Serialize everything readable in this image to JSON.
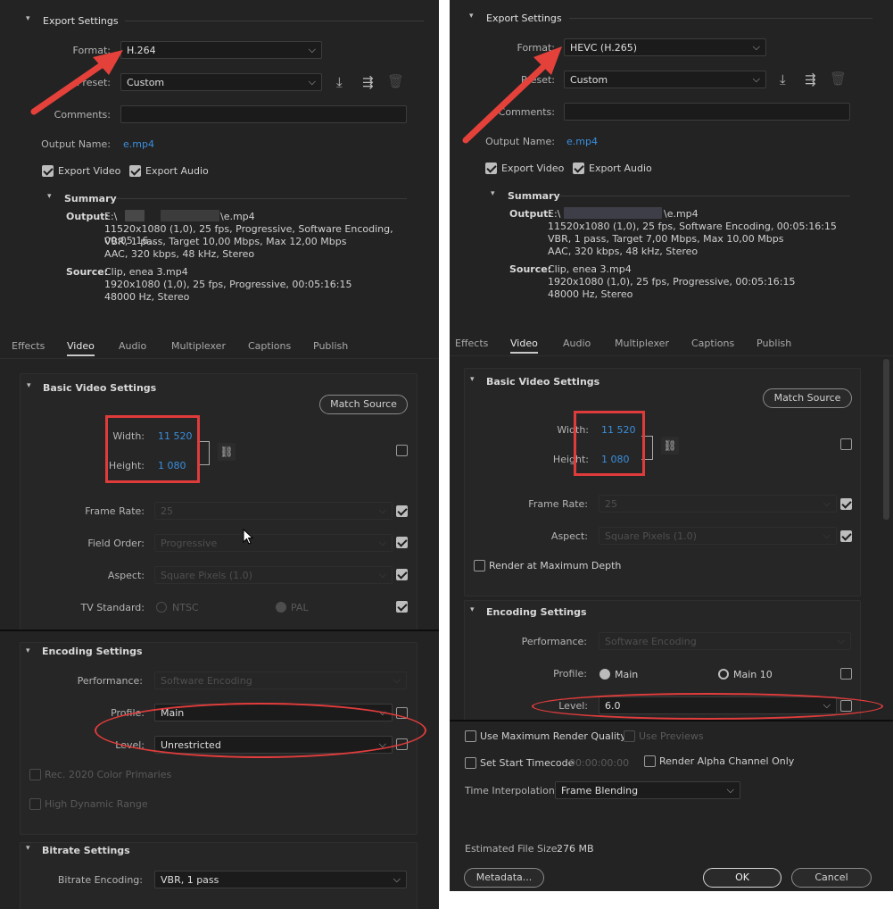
{
  "left": {
    "export_settings": {
      "title": "Export Settings",
      "format_label": "Format:",
      "format_value": "H.264",
      "preset_label": "Preset:",
      "preset_value": "Custom",
      "comments_label": "Comments:",
      "output_name_label": "Output Name:",
      "output_name_value": "e.mp4",
      "export_video_label": "Export Video",
      "export_audio_label": "Export Audio",
      "summary_title": "Summary",
      "output_label": "Output:",
      "output_path_prefix": "E:\\",
      "output_path_suffix": "\\e.mp4",
      "output_lines": [
        "11520x1080 (1,0), 25 fps, Progressive, Software Encoding, 00:05:16...",
        "VBR, 1 pass, Target 10,00 Mbps, Max 12,00 Mbps",
        "AAC, 320 kbps, 48 kHz, Stereo"
      ],
      "source_label": "Source:",
      "source_lines": [
        "Clip, enea 3.mp4",
        "1920x1080 (1,0), 25 fps, Progressive, 00:05:16:15",
        "48000 Hz, Stereo"
      ]
    },
    "tabs": [
      "Effects",
      "Video",
      "Audio",
      "Multiplexer",
      "Captions",
      "Publish"
    ],
    "basic_video": {
      "title": "Basic Video Settings",
      "match_source": "Match Source",
      "width_label": "Width:",
      "width_value": "11 520",
      "height_label": "Height:",
      "height_value": "1 080",
      "frame_rate_label": "Frame Rate:",
      "frame_rate_value": "25",
      "field_order_label": "Field Order:",
      "field_order_value": "Progressive",
      "aspect_label": "Aspect:",
      "aspect_value": "Square Pixels (1.0)",
      "tv_standard_label": "TV Standard:",
      "ntsc": "NTSC",
      "pal": "PAL"
    },
    "encoding": {
      "title": "Encoding Settings",
      "performance_label": "Performance:",
      "performance_value": "Software Encoding",
      "profile_label": "Profile:",
      "profile_value": "Main",
      "level_label": "Level:",
      "level_value": "Unrestricted",
      "rec2020": "Rec. 2020 Color Primaries",
      "hdr": "High Dynamic Range"
    },
    "bitrate": {
      "title": "Bitrate Settings",
      "encoding_label": "Bitrate Encoding:",
      "encoding_value": "VBR, 1 pass"
    }
  },
  "right": {
    "export_settings": {
      "title": "Export Settings",
      "format_label": "Format:",
      "format_value": "HEVC (H.265)",
      "preset_label": "Preset:",
      "preset_value": "Custom",
      "comments_label": "Comments:",
      "output_name_label": "Output Name:",
      "output_name_value": "e.mp4",
      "export_video_label": "Export Video",
      "export_audio_label": "Export Audio",
      "summary_title": "Summary",
      "output_label": "Output:",
      "output_path_prefix": "E:\\",
      "output_path_suffix": "\\e.mp4",
      "output_lines": [
        "11520x1080 (1,0), 25 fps, Software Encoding, 00:05:16:15",
        "VBR, 1 pass, Target 7,00 Mbps, Max 10,00 Mbps",
        "AAC, 320 kbps, 48 kHz, Stereo"
      ],
      "source_label": "Source:",
      "source_lines": [
        "Clip, enea 3.mp4",
        "1920x1080 (1,0), 25 fps, Progressive, 00:05:16:15",
        "48000 Hz, Stereo"
      ]
    },
    "tabs": [
      "Effects",
      "Video",
      "Audio",
      "Multiplexer",
      "Captions",
      "Publish"
    ],
    "basic_video": {
      "title": "Basic Video Settings",
      "match_source": "Match Source",
      "width_label": "Width:",
      "width_value": "11 520",
      "height_label": "Height:",
      "height_value": "1 080",
      "frame_rate_label": "Frame Rate:",
      "frame_rate_value": "25",
      "aspect_label": "Aspect:",
      "aspect_value": "Square Pixels (1.0)",
      "render_max_depth": "Render at Maximum Depth"
    },
    "encoding": {
      "title": "Encoding Settings",
      "performance_label": "Performance:",
      "performance_value": "Software Encoding",
      "profile_label": "Profile:",
      "profile_main": "Main",
      "profile_main10": "Main 10",
      "level_label": "Level:",
      "level_value": "6.0"
    },
    "footer": {
      "max_render_quality": "Use Maximum Render Quality",
      "use_previews": "Use Previews",
      "set_start_timecode": "Set Start Timecode",
      "timecode_value": "00:00:00:00",
      "render_alpha": "Render Alpha Channel Only",
      "time_interp_label": "Time Interpolation:",
      "time_interp_value": "Frame Blending",
      "file_size_label": "Estimated File Size:",
      "file_size_value": "276 MB",
      "metadata_btn": "Metadata...",
      "ok_btn": "OK",
      "cancel_btn": "Cancel"
    }
  },
  "colors": {
    "panel_bg": "#232323",
    "accent_link": "#3a8fde",
    "annotation_red": "#e03b3b"
  },
  "icons": [
    "chevron-down-icon",
    "import-preset-icon",
    "save-preset-icon",
    "delete-preset-icon",
    "link-chain-icon",
    "mouse-cursor-icon",
    "arrow-annotation"
  ]
}
